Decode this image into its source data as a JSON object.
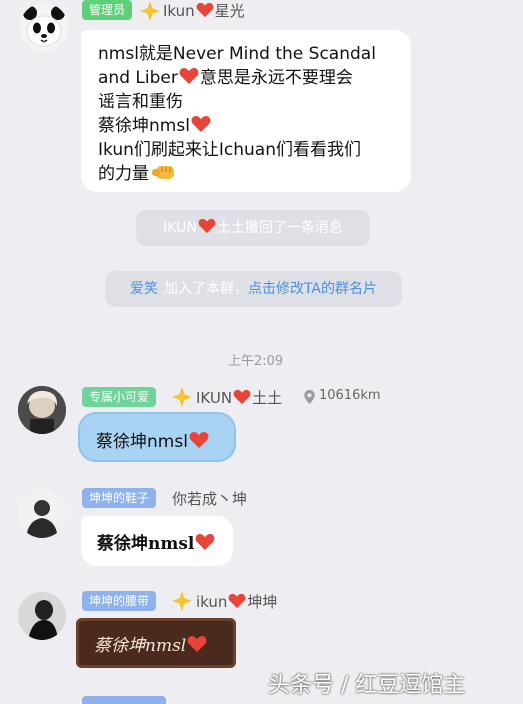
{
  "messages": [
    {
      "tag": "管理员",
      "sender_prefix": "Ikun",
      "sender_suffix": "星光",
      "lines": [
        "nmsl就是Never Mind the Scandal",
        "and Liber",
        "意思是永远不要理会",
        "谣言和重伤",
        "蔡徐坤nmsl",
        "Ikun们刷起来让Ichuan们看看我们",
        "的力量"
      ]
    },
    {
      "tag": "专属小可爱",
      "sender_prefix": "IKUN",
      "sender_suffix": "土土",
      "location": "10616km",
      "text": "蔡徐坤nmsl"
    },
    {
      "tag": "坤坤的鞋子",
      "sender": "你若成丶坤",
      "text": "蔡徐坤nmsl"
    },
    {
      "tag": "坤坤的腰带",
      "sender_prefix": "ikun",
      "sender_suffix": "坤坤",
      "text": "蔡徐坤nmsl"
    }
  ],
  "system": {
    "recall_prefix": "IKUN",
    "recall_suffix": "土土撤回了一条消息",
    "join_name": "爱笑",
    "join_text": "加入了本群，",
    "join_link": "点击修改TA的群名片",
    "timestamp": "上午2:09"
  },
  "watermark": "头条号 / 红豆逗馆主",
  "colors": {
    "admin_tag": "#5ed07a",
    "title_tag": "#6fd49a",
    "blue_tag": "#8db2ee",
    "link": "#4a90e2",
    "heart": "#e8443a",
    "blue_bubble": "#a9d3f3",
    "brown_bubble": "#4a2a1d"
  }
}
